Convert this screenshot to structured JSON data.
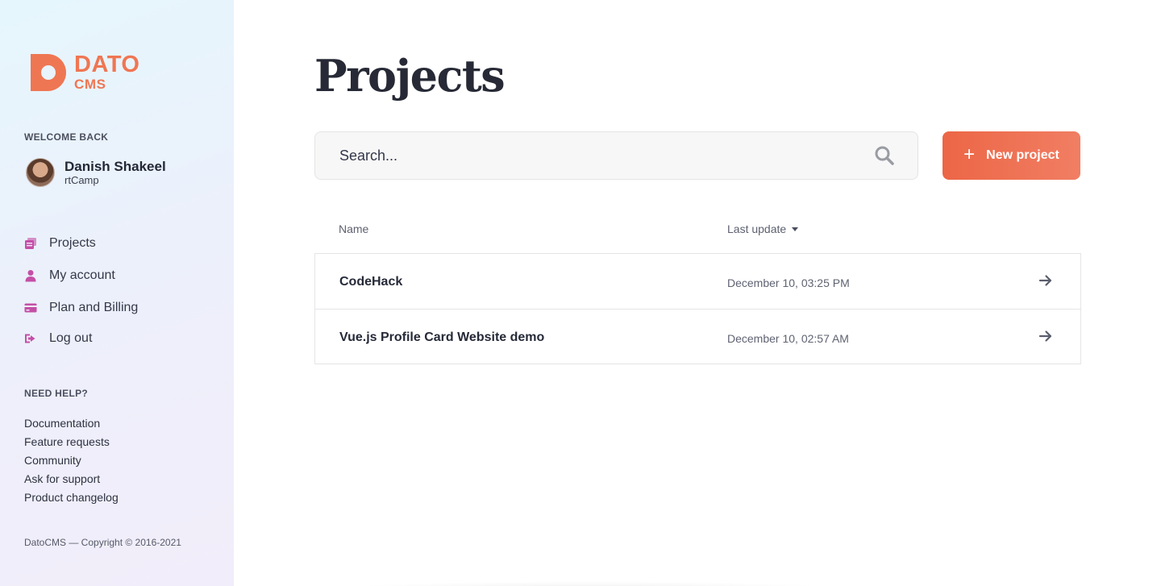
{
  "brand": {
    "name_line1": "DATO",
    "name_line2": "CMS",
    "color": "#ef7653"
  },
  "sidebar": {
    "welcome_label": "WELCOME BACK",
    "user": {
      "name": "Danish Shakeel",
      "org": "rtCamp"
    },
    "nav": [
      {
        "label": "Projects",
        "icon": "projects-icon"
      },
      {
        "label": "My account",
        "icon": "user-icon"
      },
      {
        "label": "Plan and Billing",
        "icon": "credit-card-icon"
      },
      {
        "label": "Log out",
        "icon": "logout-icon"
      }
    ],
    "help_label": "NEED HELP?",
    "help_links": [
      "Documentation",
      "Feature requests",
      "Community",
      "Ask for support",
      "Product changelog"
    ],
    "copyright": "DatoCMS — Copyright © 2016-2021",
    "icon_color": "#c44fa6"
  },
  "main": {
    "title": "Projects",
    "search": {
      "placeholder": "Search...",
      "value": ""
    },
    "new_project_label": "New project",
    "accent_color": "#ec6646",
    "table": {
      "columns": {
        "name": "Name",
        "last_update": "Last update"
      },
      "sort": "Last update, descending",
      "rows": [
        {
          "name": "CodeHack",
          "last_update": "December 10, 03:25 PM"
        },
        {
          "name": "Vue.js Profile Card Website demo",
          "last_update": "December 10, 02:57 AM"
        }
      ]
    }
  }
}
